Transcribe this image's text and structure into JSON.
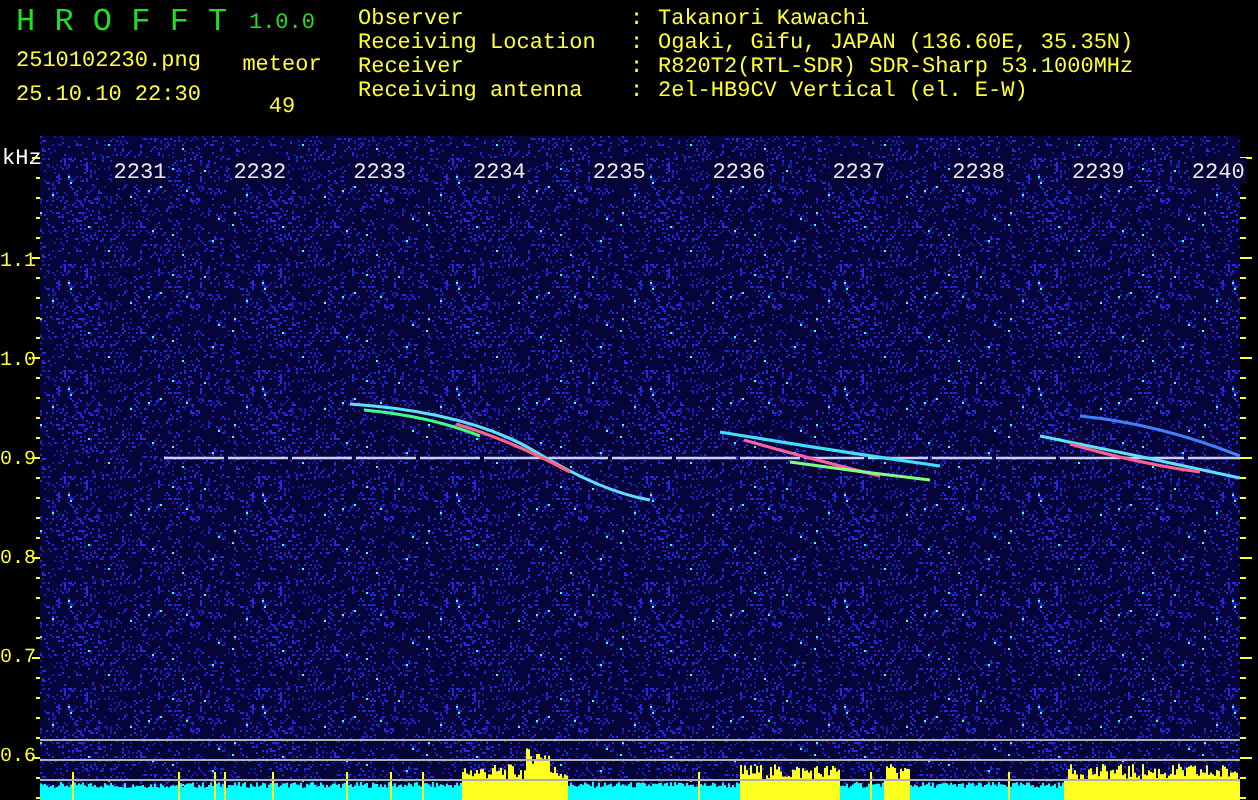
{
  "header": {
    "title": "H R O F F T",
    "version": "1.0.0",
    "file_name": "2510102230.png",
    "date_time": "25.10.10 22:30",
    "count_label": "meteor",
    "count": "49"
  },
  "info": [
    {
      "label": "Observer",
      "separator": ":",
      "value": "Takanori Kawachi"
    },
    {
      "label": "Receiving Location",
      "separator": ":",
      "value": "Ogaki, Gifu, JAPAN (136.60E, 35.35N)"
    },
    {
      "label": "Receiver",
      "separator": ":",
      "value": "R820T2(RTL-SDR) SDR-Sharp 53.1000MHz"
    },
    {
      "label": "Receiving antenna",
      "separator": ":",
      "value": "2el-HB9CV Vertical (el. E-W)"
    }
  ],
  "spectrogram": {
    "unit": "kHz",
    "time_labels": [
      "2231",
      "2232",
      "2233",
      "2234",
      "2235",
      "2236",
      "2237",
      "2238",
      "2239",
      "2240"
    ],
    "frequency_labels": [
      "1.1",
      "1.0",
      "0.9",
      "0.8",
      "0.7",
      "0.6"
    ]
  }
}
